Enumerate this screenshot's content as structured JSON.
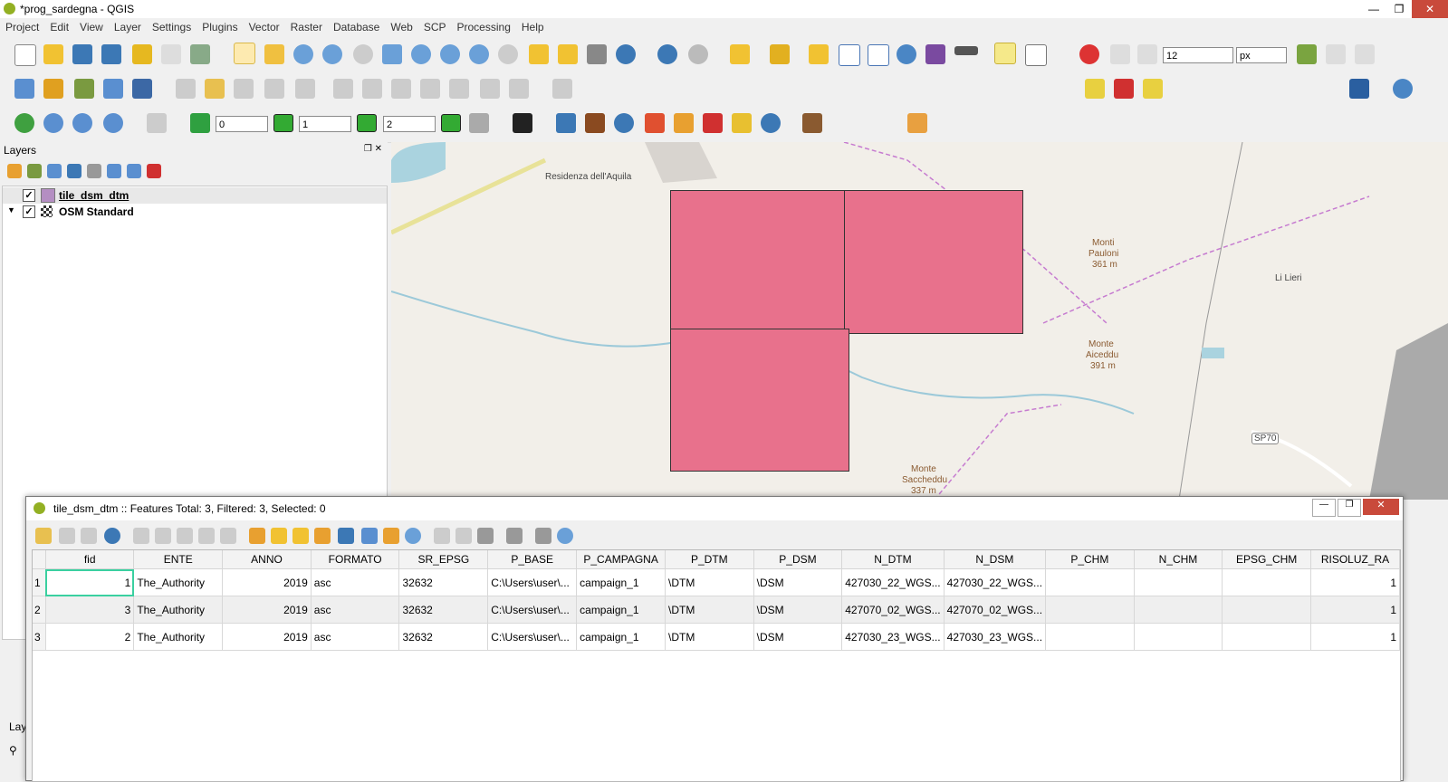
{
  "window": {
    "title": "*prog_sardegna - QGIS"
  },
  "menu": [
    "Project",
    "Edit",
    "View",
    "Layer",
    "Settings",
    "Plugins",
    "Vector",
    "Raster",
    "Database",
    "Web",
    "SCP",
    "Processing",
    "Help"
  ],
  "toolbar": {
    "font_size": "12",
    "font_unit": "px",
    "spin0": "0",
    "spin1": "1",
    "spin2": "2"
  },
  "layers_panel": {
    "title": "Layers",
    "items": [
      {
        "name": "tile_dsm_dtm",
        "checked": true,
        "swatch": "#b48ec2"
      },
      {
        "name": "OSM Standard",
        "checked": true
      }
    ],
    "bottom_tab": "Lay"
  },
  "map": {
    "labels": [
      "Residenza dell'Aquila",
      "Monti",
      "Pauloni",
      "361 m",
      "Li Lieri",
      "Monte",
      "Aiceddu",
      "391 m",
      "SP70",
      "Monte",
      "Saccheddu",
      "337 m"
    ],
    "polygon_color": "#e8718c"
  },
  "attribute_table": {
    "title": "tile_dsm_dtm :: Features Total: 3, Filtered: 3, Selected: 0",
    "columns": [
      "fid",
      "ENTE",
      "ANNO",
      "FORMATO",
      "SR_EPSG",
      "P_BASE",
      "P_CAMPAGNA",
      "P_DTM",
      "P_DSM",
      "N_DTM",
      "N_DSM",
      "P_CHM",
      "N_CHM",
      "EPSG_CHM",
      "RISOLUZ_RA"
    ],
    "rows": [
      [
        "1",
        "1",
        "The_Authority",
        "2019",
        "asc",
        "32632",
        "C:\\Users\\user\\...",
        "campaign_1",
        "\\DTM",
        "\\DSM",
        "427030_22_WGS...",
        "427030_22_WGS...",
        "",
        "",
        "",
        "1"
      ],
      [
        "2",
        "3",
        "The_Authority",
        "2019",
        "asc",
        "32632",
        "C:\\Users\\user\\...",
        "campaign_1",
        "\\DTM",
        "\\DSM",
        "427070_02_WGS...",
        "427070_02_WGS...",
        "",
        "",
        "",
        "1"
      ],
      [
        "3",
        "2",
        "The_Authority",
        "2019",
        "asc",
        "32632",
        "C:\\Users\\user\\...",
        "campaign_1",
        "\\DTM",
        "\\DSM",
        "427030_23_WGS...",
        "427030_23_WGS...",
        "",
        "",
        "",
        "1"
      ]
    ]
  },
  "colors": {
    "accent": "#e8718c",
    "selection": "#3ad0a0"
  }
}
